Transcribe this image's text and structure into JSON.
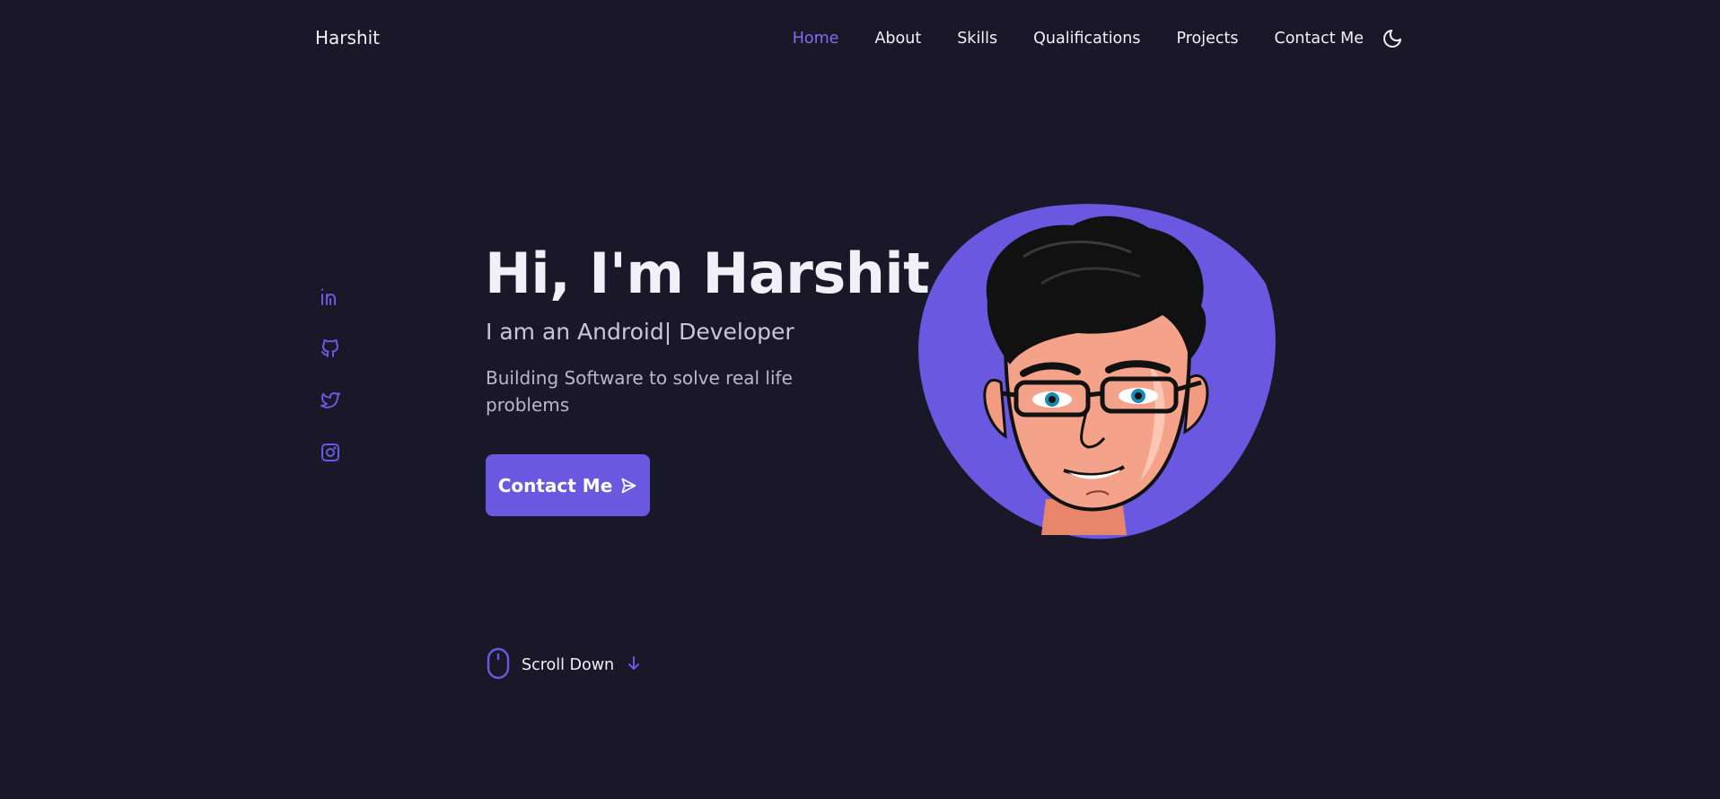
{
  "brand": {
    "name": "Harshit"
  },
  "nav": {
    "items": [
      {
        "label": "Home",
        "active": true
      },
      {
        "label": "About"
      },
      {
        "label": "Skills"
      },
      {
        "label": "Qualifications"
      },
      {
        "label": "Projects"
      },
      {
        "label": "Contact Me"
      }
    ],
    "theme_icon": "moon-icon"
  },
  "social": {
    "icons": [
      "linkedin-icon",
      "github-icon",
      "twitter-icon",
      "instagram-icon"
    ]
  },
  "hero": {
    "title": "Hi, I'm Harshit",
    "subtitle": "I am an Android| Developer",
    "description": "Building Software to solve real life problems",
    "button_label": "Contact Me",
    "button_icon": "send-icon"
  },
  "scroll": {
    "label": "Scroll Down",
    "mouse_icon": "mouse-icon",
    "arrow_icon": "arrow-down-icon"
  },
  "colors": {
    "background": "#1a1828",
    "accent": "#6b58e0",
    "text": "#f1f0f7"
  }
}
